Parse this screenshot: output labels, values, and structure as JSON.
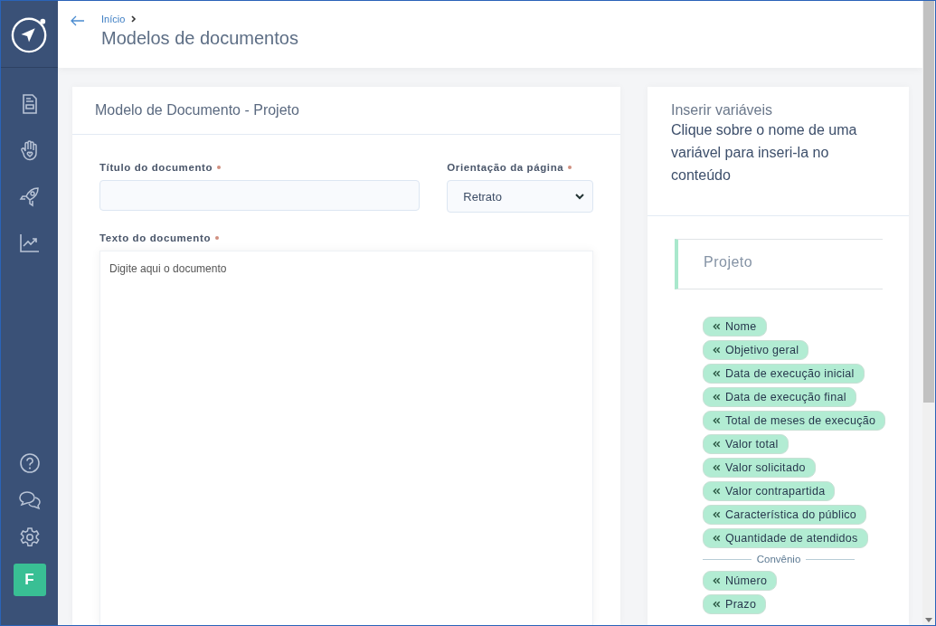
{
  "sidebar": {
    "avatar": "F"
  },
  "header": {
    "breadcrumb": [
      "Início"
    ],
    "title": "Modelos de documentos"
  },
  "form": {
    "title": "Modelo de Documento - Projeto",
    "fields": [
      {
        "label": "Título do documento",
        "required": true,
        "kind": "text"
      },
      {
        "label": "Orientação da página",
        "required": true,
        "kind": "select",
        "value": "Retrato"
      }
    ],
    "editor": {
      "label": "Texto do documento",
      "required": true,
      "placeholder": "Digite aqui o documento"
    }
  },
  "variables": {
    "title": "Inserir variáveis",
    "hint": "Clique sobre o nome de uma variável para inseri-la no conteúdo",
    "group": "Projeto",
    "items": [
      {
        "kind": "chip",
        "label": "Nome"
      },
      {
        "kind": "chip",
        "label": "Objetivo geral"
      },
      {
        "kind": "chip",
        "label": "Data de execução inicial"
      },
      {
        "kind": "chip",
        "label": "Data de execução final"
      },
      {
        "kind": "chip",
        "label": "Total de meses de execução"
      },
      {
        "kind": "chip",
        "label": "Valor total"
      },
      {
        "kind": "chip",
        "label": "Valor solicitado"
      },
      {
        "kind": "chip",
        "label": "Valor contrapartida"
      },
      {
        "kind": "chip",
        "label": "Característica do público"
      },
      {
        "kind": "chip",
        "label": "Quantidade de atendidos"
      },
      {
        "kind": "divider",
        "label": "Convênio"
      },
      {
        "kind": "chip",
        "label": "Número"
      },
      {
        "kind": "chip",
        "label": "Prazo"
      }
    ]
  }
}
